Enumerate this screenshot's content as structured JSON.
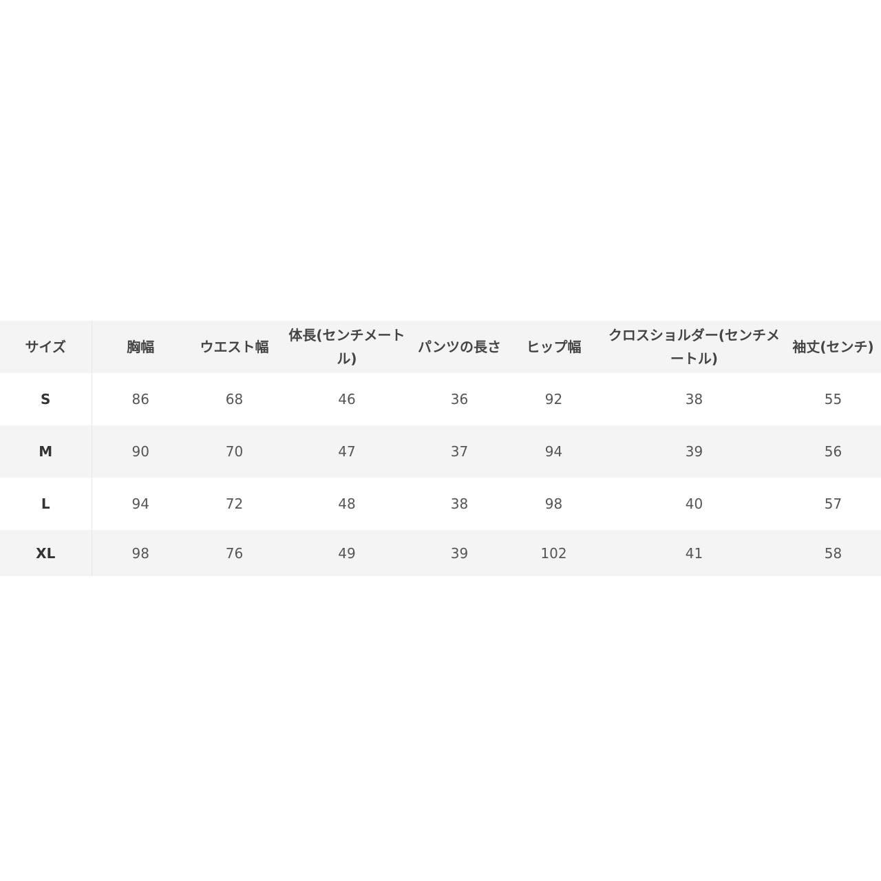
{
  "headers": [
    "サイズ",
    "胸幅",
    "ウエスト幅",
    "体長(センチメートル)",
    "パンツの長さ",
    "ヒップ幅",
    "クロスショルダー(センチメートル)",
    "袖丈(センチ)"
  ],
  "rows": [
    [
      "S",
      "86",
      "68",
      "46",
      "36",
      "92",
      "38",
      "55"
    ],
    [
      "M",
      "90",
      "70",
      "47",
      "37",
      "94",
      "39",
      "56"
    ],
    [
      "L",
      "94",
      "72",
      "48",
      "38",
      "98",
      "40",
      "57"
    ],
    [
      "XL",
      "98",
      "76",
      "49",
      "39",
      "102",
      "41",
      "58"
    ]
  ]
}
